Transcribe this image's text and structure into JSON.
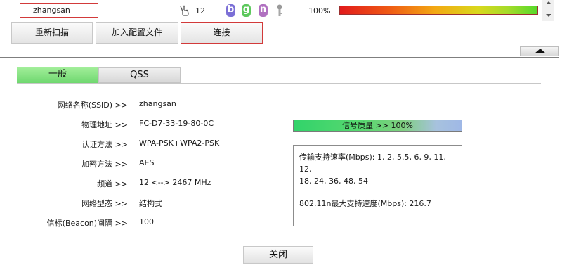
{
  "network_row": {
    "ssid": "zhangsan",
    "channel": "12",
    "mode_b": "b",
    "mode_g": "g",
    "mode_n": "n",
    "signal_percent": "100%",
    "signal_level": 1.0
  },
  "buttons": {
    "rescan": "重新扫描",
    "add_profile": "加入配置文件",
    "connect": "连接"
  },
  "tabs": {
    "general": "一般",
    "qss": "QSS"
  },
  "details": [
    {
      "label": "网络名称(SSID) >>",
      "value": "zhangsan"
    },
    {
      "label": "物理地址 >>",
      "value": "FC-D7-33-19-80-0C"
    },
    {
      "label": "认证方法 >>",
      "value": "WPA-PSK+WPA2-PSK"
    },
    {
      "label": "加密方法 >>",
      "value": "AES"
    },
    {
      "label": "频道 >>",
      "value": "12 <--> 2467 MHz"
    },
    {
      "label": "网络型态 >>",
      "value": "结构式"
    },
    {
      "label": "信标(Beacon)间隔 >>",
      "value": "100"
    }
  ],
  "signal_quality": "信号质量 >> 100%",
  "rates": {
    "supported_line1": "传输支持速率(Mbps): 1, 2, 5.5, 6, 9, 11, 12,",
    "supported_line2": "18, 24, 36, 48, 54",
    "max_11n": "802.11n最大支持速度(Mbps): 216.7"
  },
  "close": "关闭",
  "colors": {
    "selected_border": "#d23a3a",
    "active_tab": "#8ee58a",
    "signal_start": "#e21b1b",
    "signal_end": "#55d92b"
  }
}
